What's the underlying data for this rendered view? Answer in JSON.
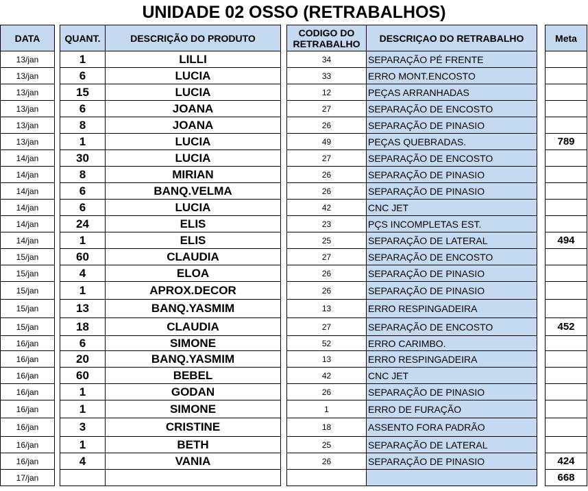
{
  "title": "UNIDADE 02 OSSO (RETRABALHOS)",
  "headers": {
    "data": "DATA",
    "quant": "QUANT.",
    "produto": "DESCRIÇÃO DO PRODUTO",
    "codigo": "CODIGO DO RETRABALHO",
    "retrabalho": "DESCRIÇAO DO RETRABALHO",
    "meta": "Meta"
  },
  "accent_color": "#c5d9f1",
  "rows": [
    {
      "date": "13/jan",
      "qty": "1",
      "product": "LILLI",
      "code": "34",
      "desc": "SEPARAÇÃO PÉ FRENTE",
      "meta": ""
    },
    {
      "date": "13/jan",
      "qty": "6",
      "product": "LUCIA",
      "code": "33",
      "desc": "ERRO MONT.ENCOSTO",
      "meta": ""
    },
    {
      "date": "13/jan",
      "qty": "15",
      "product": "LUCIA",
      "code": "12",
      "desc": "PEÇAS ARRANHADAS",
      "meta": ""
    },
    {
      "date": "13/jan",
      "qty": "6",
      "product": "JOANA",
      "code": "27",
      "desc": "SEPARAÇÃO DE ENCOSTO",
      "meta": ""
    },
    {
      "date": "13/jan",
      "qty": "8",
      "product": "JOANA",
      "code": "26",
      "desc": "SEPARAÇÃO DE PINASIO",
      "meta": ""
    },
    {
      "date": "13/jan",
      "qty": "1",
      "product": "LUCIA",
      "code": "49",
      "desc": "PEÇAS QUEBRADAS.",
      "meta": "789"
    },
    {
      "date": "14/jan",
      "qty": "30",
      "product": "LUCIA",
      "code": "27",
      "desc": "SEPARAÇÃO DE ENCOSTO",
      "meta": ""
    },
    {
      "date": "14/jan",
      "qty": "8",
      "product": "MIRIAN",
      "code": "26",
      "desc": "SEPARAÇÃO DE PINASIO",
      "meta": ""
    },
    {
      "date": "14/jan",
      "qty": "6",
      "product": "BANQ.VELMA",
      "code": "26",
      "desc": "SEPARAÇÃO DE PINASIO",
      "meta": ""
    },
    {
      "date": "14/jan",
      "qty": "6",
      "product": "LUCIA",
      "code": "42",
      "desc": "CNC JET",
      "meta": ""
    },
    {
      "date": "14/jan",
      "qty": "24",
      "product": "ELIS",
      "code": "23",
      "desc": "PÇS INCOMPLETAS EST.",
      "meta": ""
    },
    {
      "date": "14/jan",
      "qty": "1",
      "product": "ELIS",
      "code": "25",
      "desc": "SEPARAÇÃO DE LATERAL",
      "meta": "494"
    },
    {
      "date": "15/jan",
      "qty": "60",
      "product": "CLAUDIA",
      "code": "27",
      "desc": "SEPARAÇÃO DE ENCOSTO",
      "meta": ""
    },
    {
      "date": "15/jan",
      "qty": "4",
      "product": "ELOA",
      "code": "26",
      "desc": "SEPARAÇÃO DE PINASIO",
      "meta": ""
    },
    {
      "date": "15/jan",
      "qty": "1",
      "product": "APROX.DECOR",
      "code": "26",
      "desc": "SEPARAÇÃO DE PINASIO",
      "meta": ""
    },
    {
      "date": "15/jan",
      "qty": "13",
      "product": "BANQ.YASMIM",
      "code": "13",
      "desc": "ERRO RESPINGADEIRA",
      "meta": ""
    },
    {
      "date": "15/jan",
      "qty": "18",
      "product": "CLAUDIA",
      "code": "27",
      "desc": "SEPARAÇÃO DE ENCOSTO",
      "meta": "452"
    },
    {
      "date": "16/jan",
      "qty": "6",
      "product": "SIMONE",
      "code": "52",
      "desc": "ERRO CARIMBO.",
      "meta": ""
    },
    {
      "date": "16/jan",
      "qty": "20",
      "product": "BANQ.YASMIM",
      "code": "13",
      "desc": "ERRO RESPINGADEIRA",
      "meta": ""
    },
    {
      "date": "16/jan",
      "qty": "60",
      "product": "BEBEL",
      "code": "42",
      "desc": "CNC JET",
      "meta": ""
    },
    {
      "date": "16/jan",
      "qty": "1",
      "product": "GODAN",
      "code": "26",
      "desc": "SEPARAÇÃO DE PINASIO",
      "meta": ""
    },
    {
      "date": "16/jan",
      "qty": "1",
      "product": "SIMONE",
      "code": "1",
      "desc": "ERRO DE FURAÇÃO",
      "meta": ""
    },
    {
      "date": "16/jan",
      "qty": "3",
      "product": "CRISTINE",
      "code": "18",
      "desc": "ASSENTO FORA PADRÃO",
      "meta": ""
    },
    {
      "date": "16/jan",
      "qty": "1",
      "product": "BETH",
      "code": "25",
      "desc": "SEPARAÇÃO DE LATERAL",
      "meta": ""
    },
    {
      "date": "16/jan",
      "qty": "4",
      "product": "VANIA",
      "code": "26",
      "desc": "SEPARAÇÃO DE PINASIO",
      "meta": "424"
    },
    {
      "date": "17/jan",
      "qty": "",
      "product": "",
      "code": "",
      "desc": "",
      "meta": "668"
    }
  ]
}
